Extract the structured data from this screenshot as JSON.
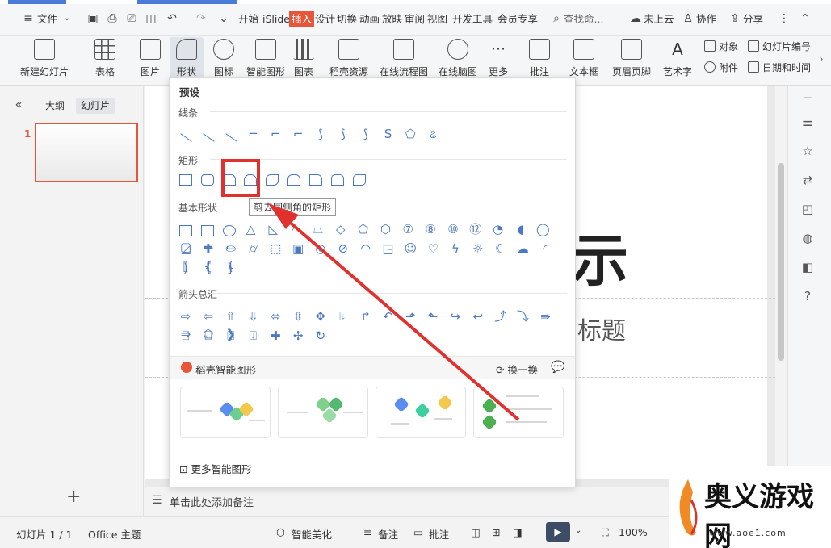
{
  "titlebar": {
    "file_menu": "文件",
    "menus": [
      "开始",
      "iSlide",
      "插入",
      "设计",
      "切换",
      "动画",
      "放映",
      "审阅",
      "视图",
      "开发工具",
      "会员专享"
    ],
    "active_menu": "插入",
    "search_placeholder": "查找命...",
    "cloud_status": "未上云",
    "collab": "协作",
    "share": "分享"
  },
  "ribbon": {
    "buttons": [
      {
        "label": "新建幻灯片",
        "icon": "new-slide-icon"
      },
      {
        "label": "表格",
        "icon": "table-icon"
      },
      {
        "label": "图片",
        "icon": "picture-icon"
      },
      {
        "label": "形状",
        "icon": "shape-icon"
      },
      {
        "label": "图标",
        "icon": "icon-library-icon"
      },
      {
        "label": "智能图形",
        "icon": "smart-graphic-icon"
      },
      {
        "label": "图表",
        "icon": "chart-icon"
      },
      {
        "label": "稻壳资源",
        "icon": "resource-icon"
      },
      {
        "label": "在线流程图",
        "icon": "flowchart-icon"
      },
      {
        "label": "在线脑图",
        "icon": "mindmap-icon"
      },
      {
        "label": "更多",
        "icon": "more-icon"
      },
      {
        "label": "批注",
        "icon": "comment-icon"
      },
      {
        "label": "文本框",
        "icon": "textbox-icon"
      },
      {
        "label": "页眉页脚",
        "icon": "header-footer-icon"
      },
      {
        "label": "艺术字",
        "icon": "wordart-icon"
      }
    ],
    "small_buttons": {
      "object": "对象",
      "slide_number": "幻灯片编号",
      "attachment": "附件",
      "datetime": "日期和时间"
    }
  },
  "left_panel": {
    "tab_outline": "大纲",
    "tab_slides": "幻灯片",
    "slide_number": "1"
  },
  "slide": {
    "title_fragment": "示",
    "subtitle_fragment": "标题"
  },
  "shapes_panel": {
    "header": "预设",
    "sections": {
      "lines": "线条",
      "rectangles": "矩形",
      "basic": "基本形状",
      "arrows": "箭头总汇"
    },
    "tooltip": "剪去同侧角的矩形",
    "smart": {
      "title": "稻壳智能图形",
      "swap": "换一换",
      "more": "更多智能图形"
    }
  },
  "notes": {
    "placeholder": "单击此处添加备注"
  },
  "statusbar": {
    "slide_count": "幻灯片 1 / 1",
    "theme": "Office 主题",
    "beautify": "智能美化",
    "notes": "备注",
    "comments": "批注",
    "zoom": "100%"
  },
  "watermark": {
    "text": "奥义游戏网",
    "url": "www.aoe1.com"
  },
  "colors": {
    "accent": "#e8563a",
    "shape_stroke": "#4a78c2",
    "highlight": "#e0312e"
  }
}
